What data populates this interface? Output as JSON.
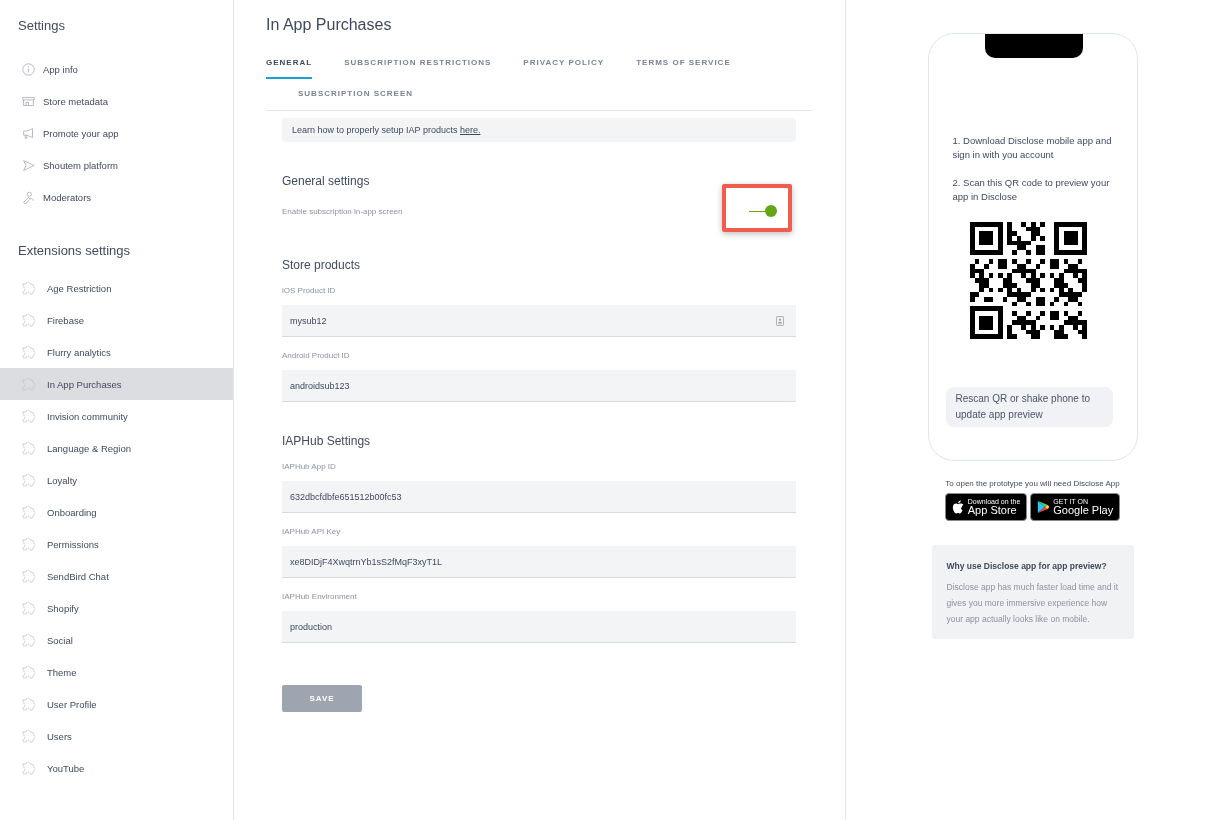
{
  "sidebar": {
    "settings_title": "Settings",
    "settings_items": [
      {
        "label": "App info",
        "selected": false
      },
      {
        "label": "Store metadata",
        "selected": false
      },
      {
        "label": "Promote your app",
        "selected": false
      },
      {
        "label": "Shoutem platform",
        "selected": false
      },
      {
        "label": "Moderators",
        "selected": false
      }
    ],
    "extensions_title": "Extensions settings",
    "extensions_items": [
      {
        "label": "Age Restriction",
        "selected": false
      },
      {
        "label": "Firebase",
        "selected": false
      },
      {
        "label": "Flurry analytics",
        "selected": false
      },
      {
        "label": "In App Purchases",
        "selected": true
      },
      {
        "label": "Invision community",
        "selected": false
      },
      {
        "label": "Language & Region",
        "selected": false
      },
      {
        "label": "Loyalty",
        "selected": false
      },
      {
        "label": "Onboarding",
        "selected": false
      },
      {
        "label": "Permissions",
        "selected": false
      },
      {
        "label": "SendBird Chat",
        "selected": false
      },
      {
        "label": "Shopify",
        "selected": false
      },
      {
        "label": "Social",
        "selected": false
      },
      {
        "label": "Theme",
        "selected": false
      },
      {
        "label": "User Profile",
        "selected": false
      },
      {
        "label": "Users",
        "selected": false
      },
      {
        "label": "YouTube",
        "selected": false
      }
    ]
  },
  "main": {
    "title": "In App Purchases",
    "tabs": [
      {
        "label": "GENERAL",
        "selected": true
      },
      {
        "label": "SUBSCRIPTION RESTRICTIONS",
        "selected": false
      },
      {
        "label": "PRIVACY POLICY",
        "selected": false
      },
      {
        "label": "TERMS OF SERVICE",
        "selected": false
      },
      {
        "label": "SUBSCRIPTION SCREEN",
        "selected": false
      }
    ],
    "info": {
      "text": "Learn how to properly setup IAP products",
      "link": "here."
    },
    "general_settings": {
      "title": "General settings",
      "toggle": {
        "label": "Enable subscription in-app screen",
        "on": true,
        "highlighted": true
      }
    },
    "store_products": {
      "title": "Store products",
      "fields": [
        {
          "label": "iOS Product ID",
          "value": "mysub12",
          "kind": "with-icon"
        },
        {
          "label": "Android Product ID",
          "value": "androidsub123",
          "kind": "plain"
        }
      ]
    },
    "iaphub_settings": {
      "title": "IAPHub Settings",
      "fields": [
        {
          "label": "IAPHub App ID",
          "value": "632dbcfdbfe651512b00fc53",
          "kind": "plain"
        },
        {
          "label": "IAPHub API Key",
          "value": "xe8DIDjF4XwqtrnYb1sS2fMqF3xyT1L",
          "kind": "plain"
        },
        {
          "label": "IAPHub Environment",
          "value": "production",
          "kind": "plain"
        }
      ]
    },
    "save_button": {
      "label": "SAVE",
      "disabled": true
    }
  },
  "preview": {
    "steps": [
      "1. Download Disclose mobile app and sign in with you account",
      "2. Scan this QR code to preview your app in Disclose"
    ],
    "rescan": "Rescan QR or shake phone to update app preview",
    "caption": "To open the prototype you will need Disclose App",
    "badges": [
      {
        "kind": "apple",
        "small": "Download on the",
        "big": "App Store"
      },
      {
        "kind": "google",
        "small": "GET IT ON",
        "big": "Google Play"
      }
    ],
    "why": {
      "title": "Why use Disclose app for app preview?",
      "text": "Disclose app has much faster load time and it gives you more immersive experience how your app actually looks like on mobile."
    }
  }
}
